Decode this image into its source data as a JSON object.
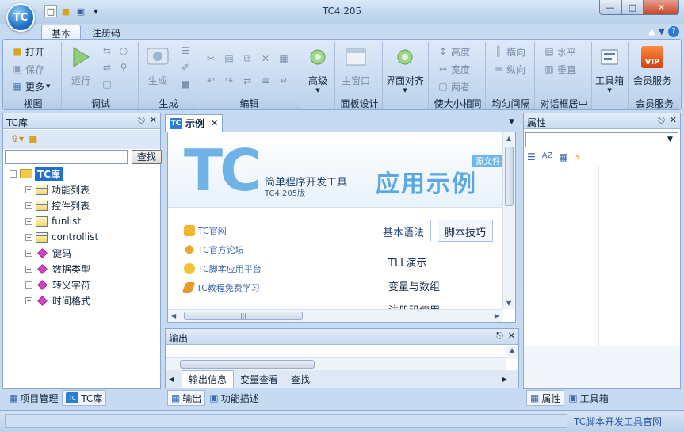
{
  "app": {
    "window_title": "TC4.205",
    "orb_label": "TC"
  },
  "ribbon_tabs": [
    "基本",
    "注册码"
  ],
  "ribbon": {
    "view_group": {
      "label": "视图",
      "open": "打开",
      "save": "保存",
      "more": "更多"
    },
    "debug_group": {
      "label": "调试",
      "run": "运行"
    },
    "build_group": {
      "label": "生成",
      "build": "生成"
    },
    "edit_group": {
      "label": "编辑"
    },
    "advanced": {
      "label": "高级"
    },
    "panel_design": {
      "label": "面板设计",
      "main_window": "主窗口"
    },
    "align_group": {
      "label": "使大小相同",
      "align_button": "界面对齐",
      "height": "高度",
      "width": "宽度",
      "both": "两者"
    },
    "spacing_group": {
      "label": "均匀间隔",
      "horizontal": "横向",
      "vertical": "纵向"
    },
    "dialog_center": {
      "label": "对话框居中",
      "horizontal": "水平",
      "vertical": "垂直"
    },
    "toolbox": {
      "label": "工具箱"
    },
    "member": {
      "label": "会员服务",
      "button": "会员服务",
      "badge": "VIP"
    }
  },
  "left_panel": {
    "title": "TC库",
    "search_button": "查找",
    "tree_root": "TC库",
    "tree_items": [
      {
        "label": "功能列表",
        "icon": "table-icon"
      },
      {
        "label": "控件列表",
        "icon": "table-icon"
      },
      {
        "label": "funlist",
        "icon": "table-icon"
      },
      {
        "label": "controllist",
        "icon": "table-icon"
      },
      {
        "label": "键码",
        "icon": "diamond-icon"
      },
      {
        "label": "数据类型",
        "icon": "diamond-icon"
      },
      {
        "label": "转义字符",
        "icon": "diamond-icon"
      },
      {
        "label": "时间格式",
        "icon": "diamond-icon"
      }
    ],
    "bottom_tabs": [
      "项目管理",
      "TC库"
    ]
  },
  "document": {
    "tab_label": "示例",
    "tab_icon_text": "TC",
    "banner": {
      "logo": "TC",
      "title": "简单程序开发工具",
      "version": "TC4.205版",
      "headline": "应用示例",
      "source_badge": "源文件"
    },
    "links": [
      "TC官网",
      "TC官方论坛",
      "TC脚本应用平台",
      "TC教程免费学习"
    ],
    "tabs": [
      "基本语法",
      "脚本技巧"
    ],
    "tab_items": [
      "TLL演示",
      "变量与数组",
      "注册码使用"
    ]
  },
  "output_panel": {
    "title": "输出",
    "tabs": [
      "输出信息",
      "变量查看",
      "查找"
    ],
    "bottom_tabs": [
      "输出",
      "功能描述"
    ]
  },
  "properties_panel": {
    "title": "属性",
    "bottom_tabs": [
      "属性",
      "工具箱"
    ]
  },
  "statusbar": {
    "link": "TC脚本开发工具官网"
  },
  "colors": {
    "accent": "#1e6fd0",
    "frame": "#c6dbf2",
    "border": "#8ba8cf",
    "link": "#2a56a6"
  }
}
